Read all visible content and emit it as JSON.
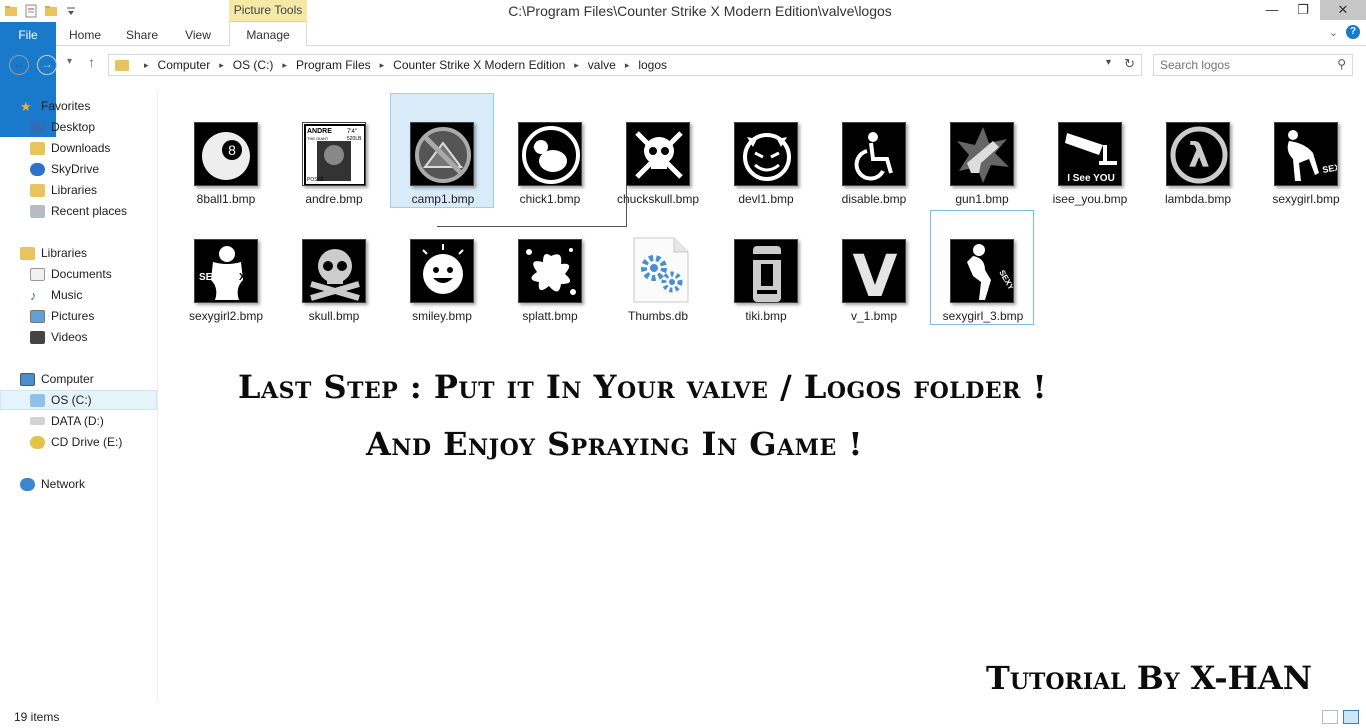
{
  "window": {
    "title": "C:\\Program Files\\Counter Strike X Modern Edition\\valve\\logos",
    "context_tab": "Picture Tools",
    "minimize": "—",
    "maximize": "❐",
    "close": "✕"
  },
  "ribbon": {
    "tabs": [
      "File",
      "Home",
      "Share",
      "View",
      "Manage"
    ],
    "collapse": "⌄",
    "help": "?"
  },
  "nav": {
    "back": "←",
    "forward": "→",
    "recent": "▾",
    "up": "↑",
    "breadcrumb": [
      "Computer",
      "OS (C:)",
      "Program Files",
      "Counter Strike X Modern Edition",
      "valve",
      "logos"
    ],
    "breadcrumb_sep": "▸",
    "dropdown": "▾",
    "refresh": "↻",
    "search_placeholder": "Search logos",
    "search_icon": "⚲"
  },
  "sidebar": {
    "favorites": {
      "label": "Favorites",
      "items": [
        "Desktop",
        "Downloads",
        "SkyDrive",
        "Libraries",
        "Recent places"
      ]
    },
    "libraries": {
      "label": "Libraries",
      "items": [
        "Documents",
        "Music",
        "Pictures",
        "Videos"
      ]
    },
    "computer": {
      "label": "Computer",
      "items": [
        "OS (C:)",
        "DATA (D:)",
        "CD Drive (E:)"
      ]
    },
    "network": {
      "label": "Network"
    }
  },
  "files": [
    {
      "name": "8ball1.bmp",
      "icon": "eight-ball-icon"
    },
    {
      "name": "andre.bmp",
      "icon": "andre-poster-icon"
    },
    {
      "name": "camp1.bmp",
      "icon": "no-camping-icon"
    },
    {
      "name": "chick1.bmp",
      "icon": "chicken-icon"
    },
    {
      "name": "chuckskull.bmp",
      "icon": "chuck-skull-icon"
    },
    {
      "name": "devl1.bmp",
      "icon": "devil-face-icon"
    },
    {
      "name": "disable.bmp",
      "icon": "wheelchair-icon"
    },
    {
      "name": "gun1.bmp",
      "icon": "gun-icon"
    },
    {
      "name": "isee_you.bmp",
      "icon": "camera-icon"
    },
    {
      "name": "lambda.bmp",
      "icon": "lambda-icon"
    },
    {
      "name": "sexygirl.bmp",
      "icon": "silhouette-icon"
    },
    {
      "name": "sexygirl2.bmp",
      "icon": "silhouette-icon"
    },
    {
      "name": "skull.bmp",
      "icon": "skull-icon"
    },
    {
      "name": "smiley.bmp",
      "icon": "smiley-icon"
    },
    {
      "name": "splatt.bmp",
      "icon": "splatter-icon"
    },
    {
      "name": "Thumbs.db",
      "icon": "system-file-icon"
    },
    {
      "name": "tiki.bmp",
      "icon": "tiki-icon"
    },
    {
      "name": "v_1.bmp",
      "icon": "v-letter-icon"
    },
    {
      "name": "sexygirl_3.bmp",
      "icon": "silhouette-icon"
    }
  ],
  "thumb_text": {
    "eight": "8",
    "andre_top": "ANDRE",
    "andre_sub": "THE GIANT",
    "andre_size": "7'4\"",
    "andre_weight": "520LB",
    "andre_posse": "POSSE",
    "isee": "I See YOU",
    "lambda": "λ",
    "sexy": "SEXY",
    "se": "SE",
    "xy": "XY",
    "v": "V"
  },
  "overlay": {
    "line1": "Last Step : Put it In Your valve / Logos folder !",
    "line2": "And Enjoy Spraying In Game !",
    "credit": "Tutorial By X-HAN"
  },
  "status": {
    "item_count": "19 items"
  },
  "colors": {
    "accent": "#1979ca",
    "selection": "#d9ebf8",
    "context_tab": "#f6e9a6"
  }
}
